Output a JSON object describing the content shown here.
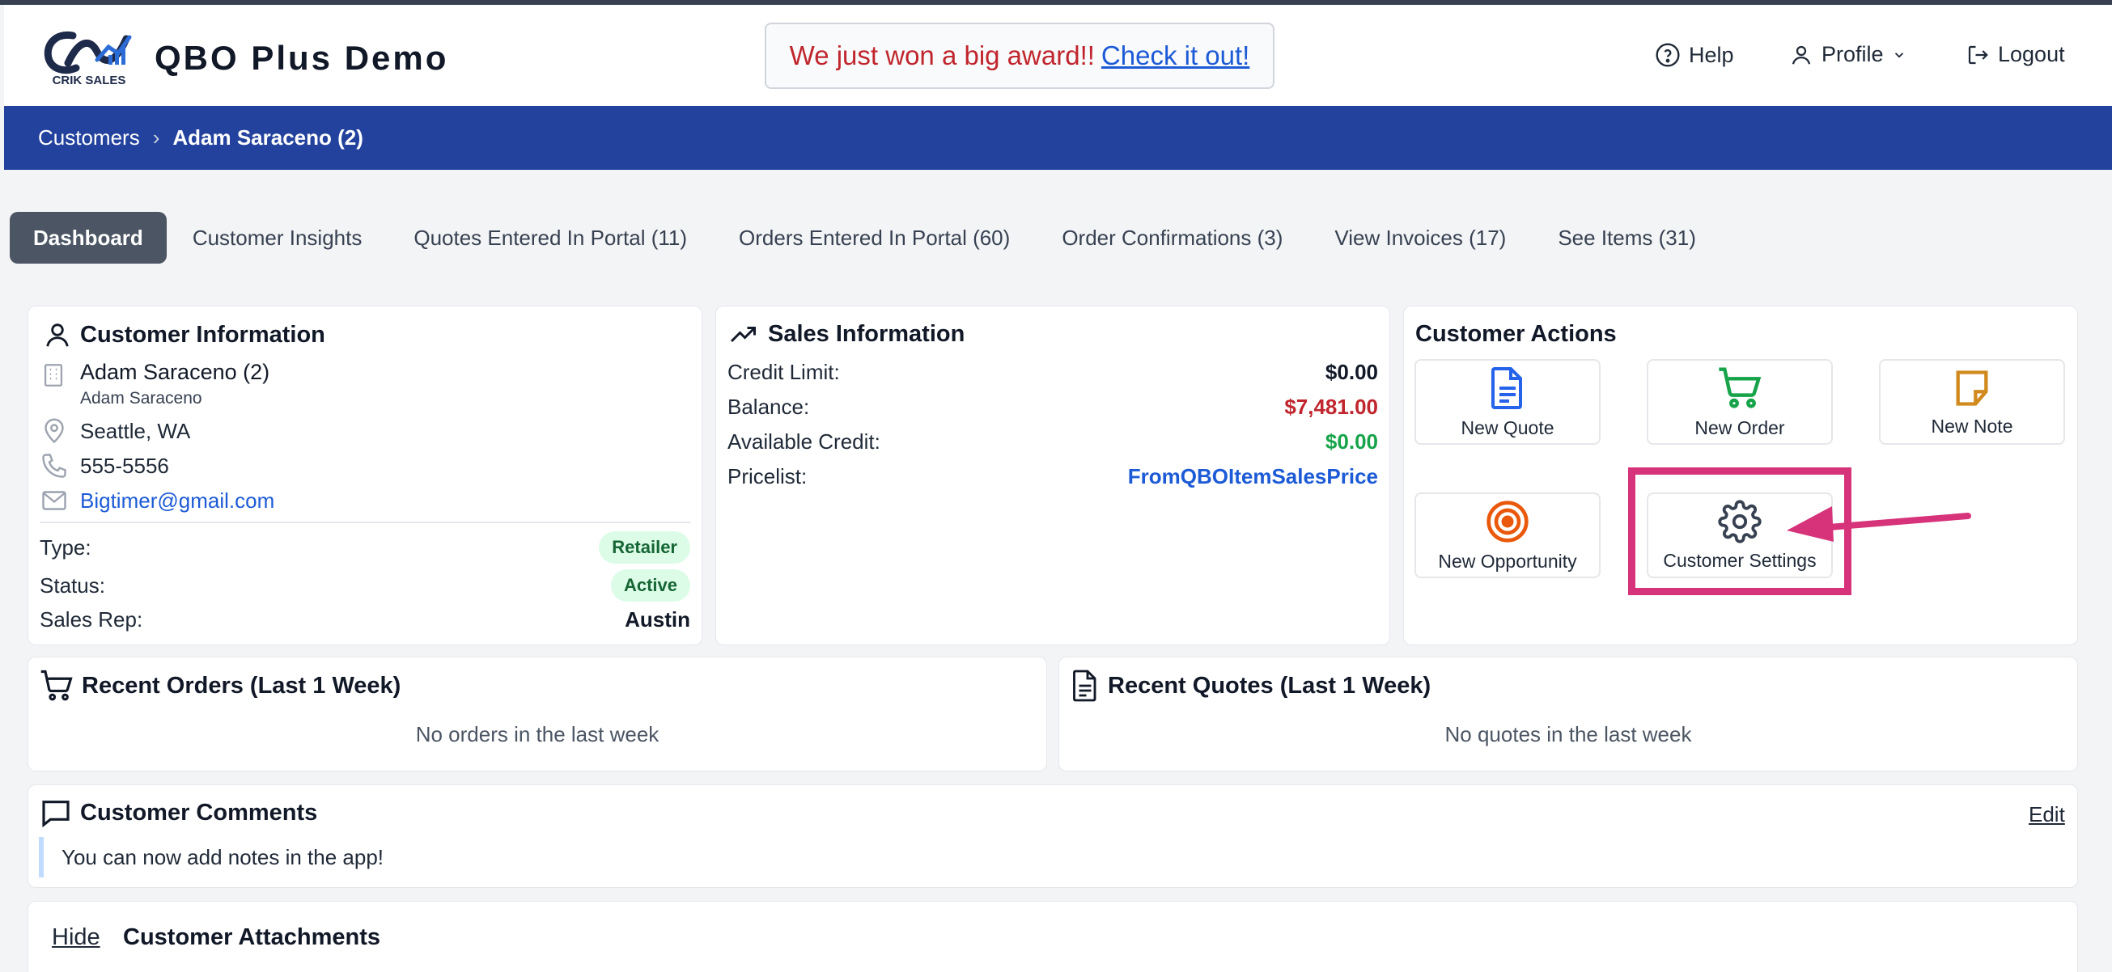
{
  "header": {
    "logo_text": "CRIK SALES",
    "app_title": "QBO Plus Demo",
    "announcement": {
      "message": "We just won a big award!!",
      "link": "Check it out!"
    },
    "nav": {
      "help": "Help",
      "profile": "Profile",
      "logout": "Logout"
    }
  },
  "breadcrumb": {
    "parent": "Customers",
    "separator": "›",
    "current": "Adam Saraceno (2)"
  },
  "tabs": [
    {
      "label": "Dashboard",
      "active": true
    },
    {
      "label": "Customer Insights"
    },
    {
      "label": "Quotes Entered In Portal (11)"
    },
    {
      "label": "Orders Entered In Portal (60)"
    },
    {
      "label": "Order Confirmations (3)"
    },
    {
      "label": "View Invoices (17)"
    },
    {
      "label": "See Items (31)"
    }
  ],
  "customer_info": {
    "title": "Customer Information",
    "name": "Adam Saraceno (2)",
    "contact": "Adam Saraceno",
    "location": "Seattle, WA",
    "phone": "555-5556",
    "email": "Bigtimer@gmail.com",
    "type_label": "Type:",
    "type_value": "Retailer",
    "status_label": "Status:",
    "status_value": "Active",
    "rep_label": "Sales Rep:",
    "rep_value": "Austin"
  },
  "sales_info": {
    "title": "Sales Information",
    "credit_limit_label": "Credit Limit:",
    "credit_limit": "$0.00",
    "balance_label": "Balance:",
    "balance": "$7,481.00",
    "available_label": "Available Credit:",
    "available": "$0.00",
    "pricelist_label": "Pricelist:",
    "pricelist": "FromQBOItemSalesPrice"
  },
  "actions": {
    "title": "Customer Actions",
    "new_quote": "New Quote",
    "new_order": "New Order",
    "new_note": "New Note",
    "new_opportunity": "New Opportunity",
    "customer_settings": "Customer Settings"
  },
  "recent_orders": {
    "title": "Recent Orders (Last 1 Week)",
    "empty": "No orders in the last week"
  },
  "recent_quotes": {
    "title": "Recent Quotes (Last 1 Week)",
    "empty": "No quotes in the last week"
  },
  "comments": {
    "title": "Customer Comments",
    "edit": "Edit",
    "text": "You can now add notes in the app!"
  },
  "attachments": {
    "hide": "Hide",
    "title": "Customer Attachments"
  },
  "colors": {
    "brand_blue": "#23429d",
    "balance_red": "#c0262d",
    "available_green": "#16a34a",
    "link_blue": "#1d5bd6",
    "highlight_pink": "#d6337a"
  }
}
